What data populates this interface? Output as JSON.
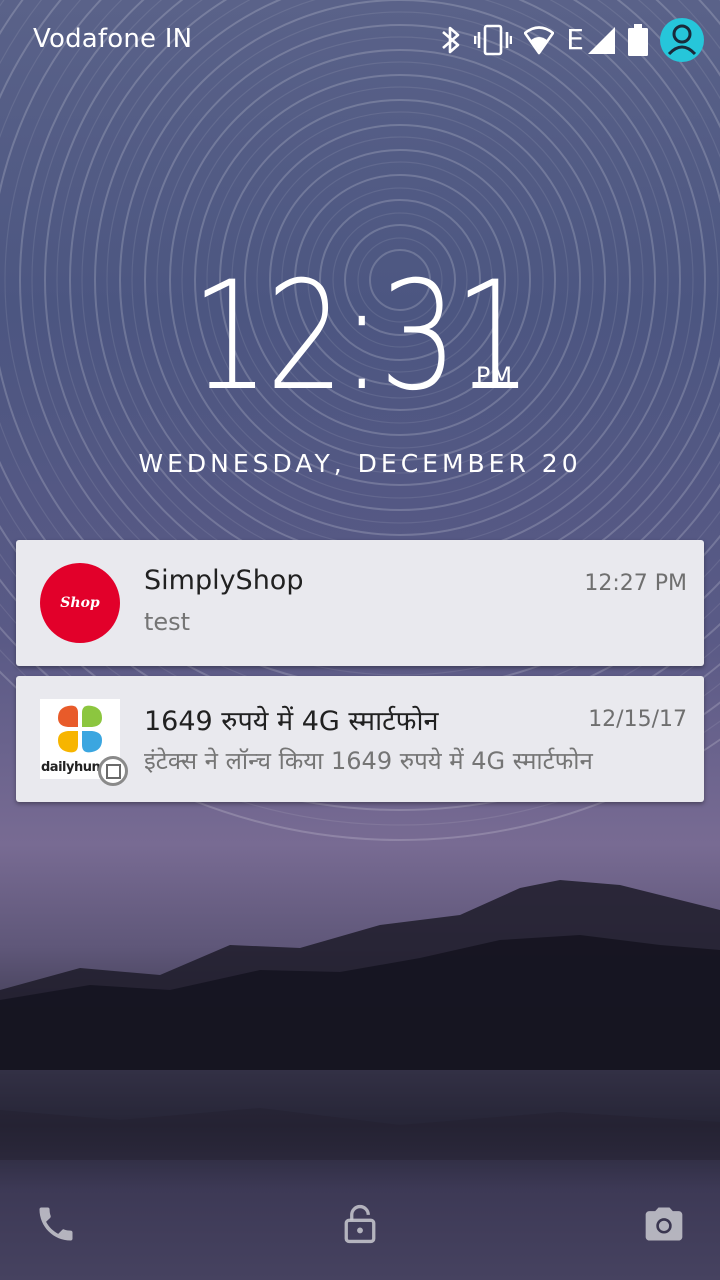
{
  "status_bar": {
    "carrier": "Vodafone IN",
    "icons": [
      "bluetooth-icon",
      "vibrate-icon",
      "wifi-icon",
      "network-type-icon",
      "signal-icon",
      "battery-icon",
      "user-avatar-icon"
    ],
    "network_type": "E"
  },
  "lockscreen": {
    "time": "12:31",
    "ampm": "PM",
    "date": "WEDNESDAY, DECEMBER 20"
  },
  "notifications": [
    {
      "app_icon_text": "Shop",
      "title": "SimplyShop",
      "body": "test",
      "time": "12:27 PM",
      "icon_color": "#e2002a"
    },
    {
      "app_icon_text": "dailyhunt",
      "title": "1649 रुपये में 4G स्मार्टफोन",
      "body": "इंटेक्स ने लॉन्च किया 1649 रुपये में 4G स्मार्टफोन",
      "time": "12/15/17"
    }
  ],
  "bottom_actions": [
    "phone-icon",
    "lock-icon",
    "camera-icon"
  ],
  "colors": {
    "notification_bg": "#e9e9ee",
    "title_text": "#212121",
    "body_text": "#757575",
    "accent_avatar": "#26c6da"
  }
}
